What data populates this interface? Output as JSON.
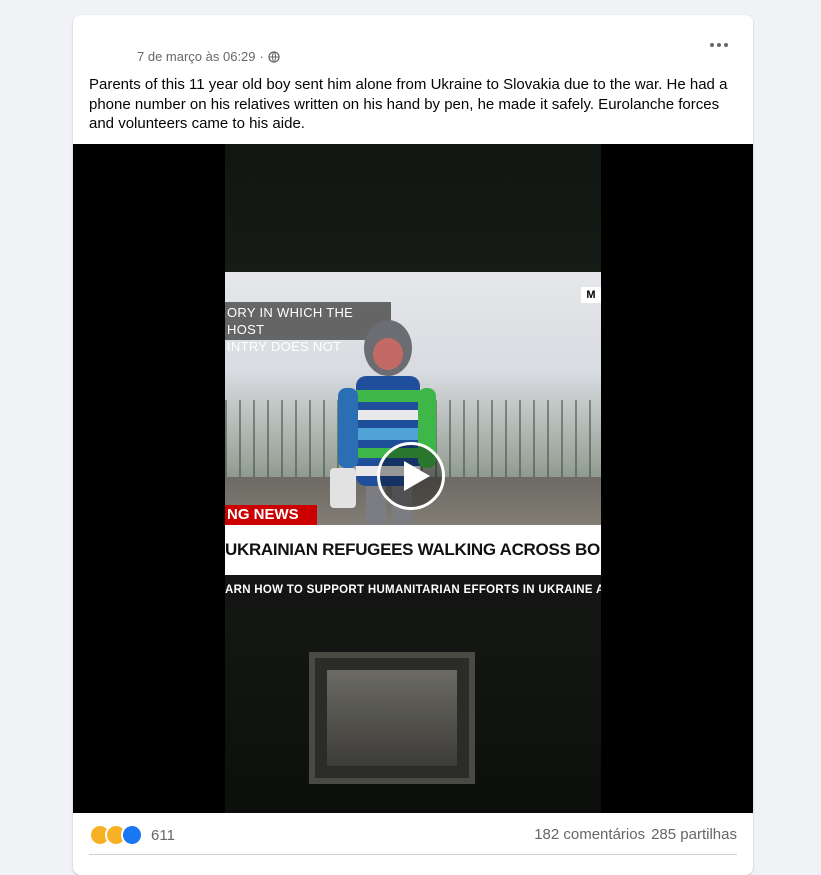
{
  "post": {
    "timestamp": "7 de março às 06:29",
    "separator": "·",
    "privacy_icon": "globe-icon",
    "more_icon": "more-options-icon",
    "text": "Parents of this 11 year old boy sent him alone from Ukraine to Slovakia due to the war. He had a phone number on his relatives written on his hand by pen, he made it safely. Eurolanche forces and volunteers came to his aide."
  },
  "video": {
    "overlay_text": "ORY IN WHICH THE HOST\nINTRY DOES NOT",
    "logo": "M",
    "breaking": "NG NEWS",
    "headline": "UKRAINIAN REFUGEES WALKING ACROSS BORDER INTO POLAN",
    "ticker": "ARN HOW TO SUPPORT HUMANITARIAN EFFORTS IN UKRAINE A",
    "play_icon": "play-icon"
  },
  "footer": {
    "reaction_icons": [
      "sad-icon",
      "care-icon",
      "like-icon"
    ],
    "reaction_count": "611",
    "comments": "182 comentários",
    "shares": "285 partilhas"
  },
  "colors": {
    "background": "#f0f2f5",
    "card": "#ffffff",
    "secondary_text": "#65676b",
    "like_blue": "#1877f2",
    "breaking_red": "#cc0000"
  }
}
